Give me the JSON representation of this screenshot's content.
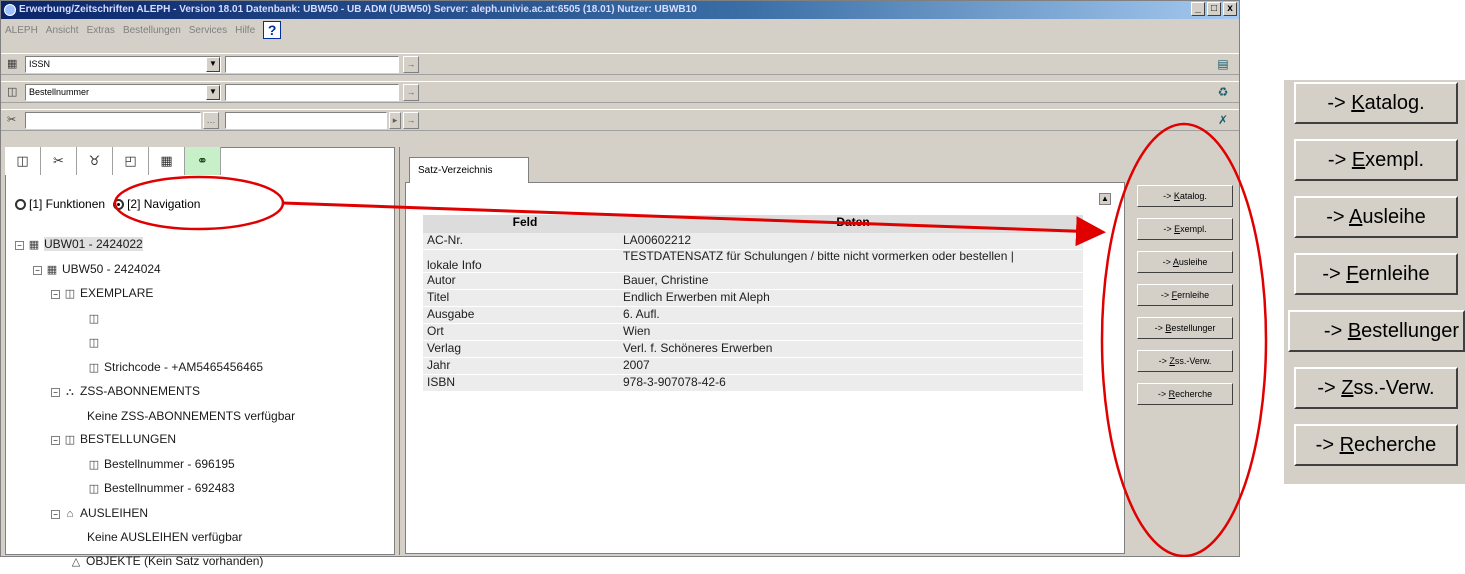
{
  "window": {
    "title": "Erwerbung/Zeitschriften ALEPH - Version 18.01 Datenbank: UBW50 - UB ADM (UBW50) Server: aleph.univie.ac.at:6505 (18.01) Nutzer: UBWB10",
    "controls": [
      "_",
      "□",
      "x"
    ]
  },
  "menu": [
    "ALEPH",
    "Ansicht",
    "Extras",
    "Bestellungen",
    "Services",
    "Hilfe"
  ],
  "search_rows": [
    {
      "combo": "ISSN"
    },
    {
      "combo": "Bestellnummer"
    },
    {
      "combo": ""
    }
  ],
  "left_panel": {
    "radio_functions": "[1] Funktionen",
    "radio_navigation": "[2] Navigation",
    "tree": [
      {
        "label": "UBW01 - 2424022",
        "level": 0
      },
      {
        "label": "UBW50 - 2424024",
        "level": 1
      },
      {
        "label": "EXEMPLARE",
        "level": 2
      },
      {
        "label": "",
        "level": 3
      },
      {
        "label": "",
        "level": 3
      },
      {
        "label": "Strichcode - +AM5465456465",
        "level": 3
      },
      {
        "label": "ZSS-ABONNEMENTS",
        "level": 2
      },
      {
        "label": "Keine ZSS-ABONNEMENTS verfügbar",
        "level": 3
      },
      {
        "label": "BESTELLUNGEN",
        "level": 2
      },
      {
        "label": "Bestellnummer - 696195",
        "level": 3
      },
      {
        "label": "Bestellnummer - 692483",
        "level": 3
      },
      {
        "label": "AUSLEIHEN",
        "level": 2
      },
      {
        "label": "Keine AUSLEIHEN verfügbar",
        "level": 3
      },
      {
        "label": "OBJEKTE (Kein Satz vorhanden)",
        "level": 2
      }
    ]
  },
  "right_panel": {
    "tab": "Satz-Verzeichnis",
    "columns": [
      "Feld",
      "Daten"
    ],
    "rows": [
      [
        "AC-Nr.",
        "LA00602212"
      ],
      [
        "lokale Info",
        "TESTDATENSATZ für Schulungen / bitte nicht vormerken oder bestellen |"
      ],
      [
        "Autor",
        "Bauer, Christine"
      ],
      [
        "Titel",
        "Endlich Erwerben mit Aleph"
      ],
      [
        "Ausgabe",
        "6. Aufl."
      ],
      [
        "Ort",
        "Wien"
      ],
      [
        "Verlag",
        "Verl. f. Schöneres Erwerben"
      ],
      [
        "Jahr",
        "2007"
      ],
      [
        "ISBN",
        "978-3-907078-42-6"
      ]
    ]
  },
  "nav_buttons": [
    {
      "prefix": "-> ",
      "ul": "K",
      "rest": "atalog."
    },
    {
      "prefix": "-> ",
      "ul": "E",
      "rest": "xempl."
    },
    {
      "prefix": "-> ",
      "ul": "A",
      "rest": "usleihe"
    },
    {
      "prefix": "-> ",
      "ul": "F",
      "rest": "ernleihe"
    },
    {
      "prefix": "-> ",
      "ul": "B",
      "rest": "estellunger"
    },
    {
      "prefix": "-> ",
      "ul": "Z",
      "rest": "ss.-Verw."
    },
    {
      "prefix": "-> ",
      "ul": "R",
      "rest": "echerche"
    }
  ],
  "zoom_buttons": [
    {
      "prefix": "-> ",
      "ul": "K",
      "rest": "atalog."
    },
    {
      "prefix": "-> ",
      "ul": "E",
      "rest": "xempl."
    },
    {
      "prefix": "-> ",
      "ul": "A",
      "rest": "usleihe"
    },
    {
      "prefix": "-> ",
      "ul": "F",
      "rest": "ernleihe"
    },
    {
      "prefix": "-> ",
      "ul": "B",
      "rest": "estellunger"
    },
    {
      "prefix": "-> ",
      "ul": "Z",
      "rest": "ss.-Verw."
    },
    {
      "prefix": "-> ",
      "ul": "R",
      "rest": "echerche"
    }
  ],
  "annotation_color": "#e00000"
}
